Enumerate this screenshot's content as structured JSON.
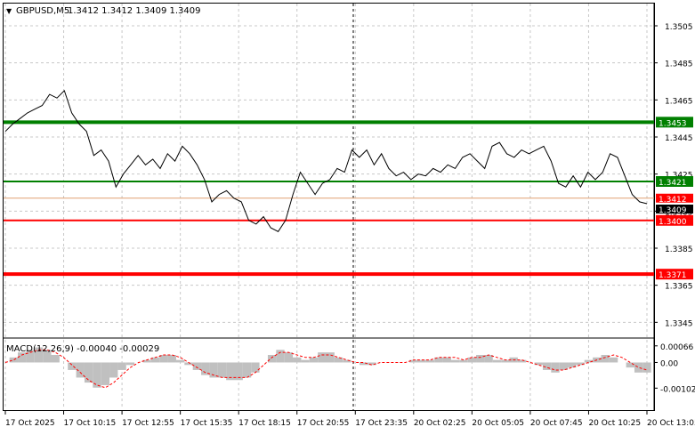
{
  "header": {
    "symbol": "GBPUSD,M5",
    "ohlc": "1.3412 1.3412 1.3409 1.3409",
    "dropdown_glyph": "▼"
  },
  "colors": {
    "background": "#ffffff",
    "price_line": "#000000",
    "green_level": "#008000",
    "red_level": "#ff0000",
    "bid_line": "#e0a070",
    "grid": "#c8c8c8",
    "macd_hist": "#c0c0c0",
    "macd_signal": "#ff0000"
  },
  "main_axis": {
    "ticks": [
      "1.3505",
      "1.3485",
      "1.3465",
      "1.3445",
      "1.3425",
      "1.3405",
      "1.3385",
      "1.3365",
      "1.3345"
    ],
    "ylim": [
      1.3337,
      1.3517
    ]
  },
  "levels": [
    {
      "value": 1.3453,
      "label": "1.3453",
      "color": "#008000",
      "width": 4
    },
    {
      "value": 1.3421,
      "label": "1.3421",
      "color": "#008000",
      "width": 2
    },
    {
      "value": 1.34,
      "label": "1.3400",
      "color": "#ff0000",
      "width": 2
    },
    {
      "value": 1.3371,
      "label": "1.3371",
      "color": "#ff0000",
      "width": 4
    }
  ],
  "price_tags": [
    {
      "value": 1.3412,
      "label": "1.3412",
      "color": "#ff0000"
    },
    {
      "value": 1.3409,
      "label": "1.3409",
      "color": "#000000"
    }
  ],
  "macd": {
    "label": "MACD(12,26,9) -0.00040 -0.00029",
    "ticks": [
      "0.00066",
      "0.00",
      "-0.00102"
    ],
    "ylim": [
      -0.00115,
      0.0009
    ]
  },
  "time_axis": {
    "labels": [
      "17 Oct 2025",
      "17 Oct 10:15",
      "17 Oct 12:55",
      "17 Oct 15:35",
      "17 Oct 18:15",
      "17 Oct 20:55",
      "17 Oct 23:35",
      "20 Oct 02:25",
      "20 Oct 05:05",
      "20 Oct 07:45",
      "20 Oct 10:25",
      "20 Oct 13:05"
    ]
  },
  "chart_data": {
    "type": "line",
    "title": "GBPUSD,M5 1.3412 1.3412 1.3409 1.3409",
    "x": [
      "17 Oct 2025",
      "17 Oct 10:15",
      "17 Oct 12:55",
      "17 Oct 15:35",
      "17 Oct 18:15",
      "17 Oct 20:55",
      "17 Oct 23:35",
      "20 Oct 02:25",
      "20 Oct 05:05",
      "20 Oct 07:45",
      "20 Oct 10:25",
      "20 Oct 13:05"
    ],
    "series": [
      {
        "values": [
          1.3448,
          1.3452,
          1.3455,
          1.3458,
          1.346,
          1.3462,
          1.3468,
          1.3466,
          1.347,
          1.3458,
          1.3452,
          1.3448,
          1.3435,
          1.3438,
          1.3432,
          1.3418,
          1.3425,
          1.343,
          1.3435,
          1.343,
          1.3433,
          1.3428,
          1.3436,
          1.3432,
          1.344,
          1.3436,
          1.343,
          1.3422,
          1.341,
          1.3414,
          1.3416,
          1.3412,
          1.341,
          1.34,
          1.3398,
          1.3402,
          1.3396,
          1.3394,
          1.34,
          1.3414,
          1.3426,
          1.342,
          1.3414,
          1.342,
          1.3422,
          1.3428,
          1.3426,
          1.3438,
          1.3434,
          1.3438,
          1.343,
          1.3436,
          1.3428,
          1.3424,
          1.3426,
          1.3422,
          1.3425,
          1.3424,
          1.3428,
          1.3426,
          1.343,
          1.3428,
          1.3434,
          1.3436,
          1.3432,
          1.3428,
          1.344,
          1.3442,
          1.3436,
          1.3434,
          1.3438,
          1.3436,
          1.3438,
          1.344,
          1.3432,
          1.342,
          1.3418,
          1.3424,
          1.3418,
          1.3426,
          1.3422,
          1.3426,
          1.3436,
          1.3434,
          1.3424,
          1.3414,
          1.341,
          1.3409
        ],
        "color": "#000000"
      }
    ],
    "ylim": [
      1.3337,
      1.3517
    ],
    "levels": [
      1.3453,
      1.3421,
      1.34,
      1.3371
    ],
    "grid": true,
    "macd": {
      "histogram": [
        0.0,
        0.0002,
        0.0004,
        0.0005,
        0.0006,
        0.0005,
        0.0003,
        0.0,
        -0.0003,
        -0.0006,
        -0.0008,
        -0.001,
        -0.0009,
        -0.0006,
        -0.0003,
        -0.0001,
        0.0,
        0.0001,
        0.0002,
        0.0003,
        0.0003,
        0.0001,
        -0.0001,
        -0.0003,
        -0.0005,
        -0.0006,
        -0.0006,
        -0.0007,
        -0.0007,
        -0.0006,
        -0.0004,
        0.0,
        0.0003,
        0.0005,
        0.0004,
        0.0002,
        0.0001,
        0.0002,
        0.0004,
        0.0004,
        0.0002,
        0.0001,
        0.0,
        -0.0001,
        -0.0001,
        0.0,
        0.0,
        0.0,
        0.0,
        0.0001,
        0.0001,
        0.0001,
        0.0002,
        0.0002,
        0.0001,
        0.0001,
        0.0002,
        0.0003,
        0.0003,
        0.0001,
        0.0001,
        0.0002,
        0.0001,
        0.0,
        -0.0001,
        -0.0003,
        -0.0004,
        -0.0003,
        -0.0002,
        -0.0001,
        0.0001,
        0.0002,
        0.0003,
        0.0002,
        0.0,
        -0.0002,
        -0.0004,
        -0.0004
      ],
      "signal": [
        0.0,
        0.0001,
        0.0003,
        0.0004,
        0.0005,
        0.0005,
        0.0004,
        0.0002,
        -0.0001,
        -0.0004,
        -0.0007,
        -0.0009,
        -0.001,
        -0.0008,
        -0.0005,
        -0.0002,
        0.0,
        0.0001,
        0.0002,
        0.0003,
        0.0003,
        0.0002,
        0.0,
        -0.0002,
        -0.0004,
        -0.0005,
        -0.0006,
        -0.0006,
        -0.0006,
        -0.0006,
        -0.0004,
        -0.0001,
        0.0002,
        0.0004,
        0.0004,
        0.0003,
        0.0002,
        0.0002,
        0.0003,
        0.0003,
        0.0002,
        0.0001,
        0.0,
        0.0,
        -0.0001,
        0.0,
        0.0,
        0.0,
        0.0,
        0.0001,
        0.0001,
        0.0001,
        0.0002,
        0.0002,
        0.0002,
        0.0001,
        0.0002,
        0.0002,
        0.0003,
        0.0002,
        0.0001,
        0.0001,
        0.0001,
        0.0,
        -0.0001,
        -0.0002,
        -0.0003,
        -0.0003,
        -0.0002,
        -0.0001,
        0.0,
        0.0001,
        0.0002,
        0.0003,
        0.0002,
        0.0,
        -0.0002,
        -0.0003
      ]
    }
  }
}
